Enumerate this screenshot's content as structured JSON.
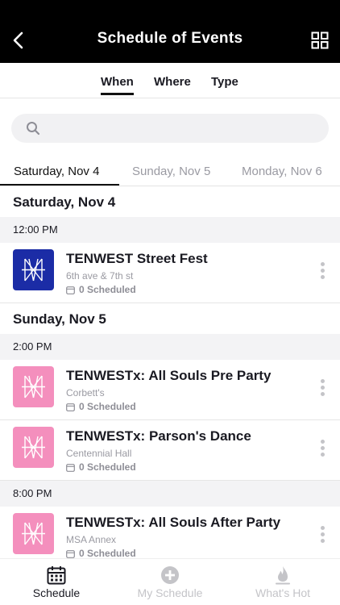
{
  "header": {
    "title": "Schedule of Events"
  },
  "filter_tabs": [
    {
      "label": "When",
      "active": true
    },
    {
      "label": "Where",
      "active": false
    },
    {
      "label": "Type",
      "active": false
    }
  ],
  "search": {
    "placeholder": "",
    "value": ""
  },
  "date_tabs": [
    {
      "label": "Saturday, Nov 4",
      "active": true
    },
    {
      "label": "Sunday, Nov 5",
      "active": false
    },
    {
      "label": "Monday, Nov 6",
      "active": false
    }
  ],
  "days": [
    {
      "heading": "Saturday, Nov 4",
      "time_groups": [
        {
          "time": "12:00 PM",
          "events": [
            {
              "title": "TENWEST Street Fest",
              "location": "6th ave & 7th st",
              "scheduled": "0 Scheduled",
              "logo_color": "#1b2ca6"
            }
          ]
        }
      ]
    },
    {
      "heading": "Sunday, Nov 5",
      "time_groups": [
        {
          "time": "2:00 PM",
          "events": [
            {
              "title": "TENWESTx: All Souls Pre Party",
              "location": "Corbett's",
              "scheduled": "0 Scheduled",
              "logo_color": "#f48fbd"
            },
            {
              "title": "TENWESTx: Parson's Dance",
              "location": "Centennial Hall",
              "scheduled": "0 Scheduled",
              "logo_color": "#f48fbd"
            }
          ]
        },
        {
          "time": "8:00 PM",
          "events": [
            {
              "title": "TENWESTx: All Souls After Party",
              "location": "MSA Annex",
              "scheduled": "0 Scheduled",
              "logo_color": "#f48fbd"
            }
          ]
        }
      ]
    }
  ],
  "bottom_nav": [
    {
      "label": "Schedule",
      "icon": "calendar-icon",
      "active": true
    },
    {
      "label": "My Schedule",
      "icon": "plus-circle-icon",
      "active": false
    },
    {
      "label": "What's Hot",
      "icon": "flame-icon",
      "active": false
    }
  ],
  "colors": {
    "header_bg": "#000000",
    "logo_blue": "#1b2ca6",
    "logo_pink": "#f48fbd",
    "inactive": "#c4c4c8"
  }
}
